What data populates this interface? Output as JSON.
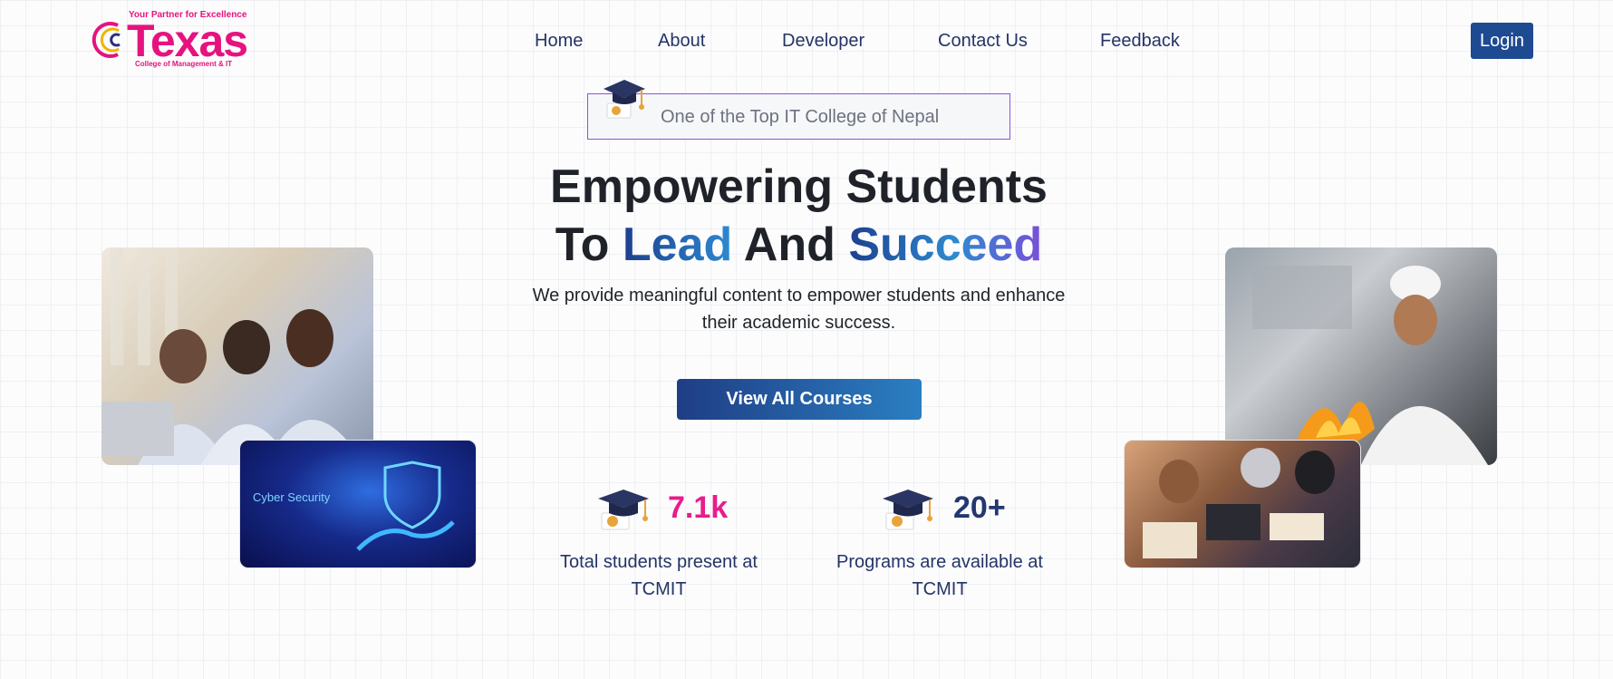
{
  "logo": {
    "tagline": "Your Partner for Excellence",
    "name": "Texas",
    "subtitle": "College of Management & IT"
  },
  "nav": {
    "items": [
      "Home",
      "About",
      "Developer",
      "Contact Us",
      "Feedback"
    ],
    "login_label": "Login"
  },
  "hero": {
    "badge_text": "One of the Top IT College of Nepal",
    "title_line1": "Empowering Students",
    "title_line2_part1": "To ",
    "title_line2_highlight1": "Lead",
    "title_line2_part2": " And ",
    "title_line2_highlight2": "Succeed",
    "description": "We provide meaningful content to empower students and enhance their academic success.",
    "cta_label": "View All Courses"
  },
  "stats": [
    {
      "value": "7.1k",
      "description": "Total students present at TCMIT",
      "color": "#e81c8c"
    },
    {
      "value": "20+",
      "description": "Programs are available at TCMIT",
      "color": "#233770"
    }
  ],
  "images": {
    "cyber_label": "Cyber Security"
  },
  "colors": {
    "brand_pink": "#e6137f",
    "navy": "#1e4a91",
    "badge_border": "#8a55d6"
  }
}
